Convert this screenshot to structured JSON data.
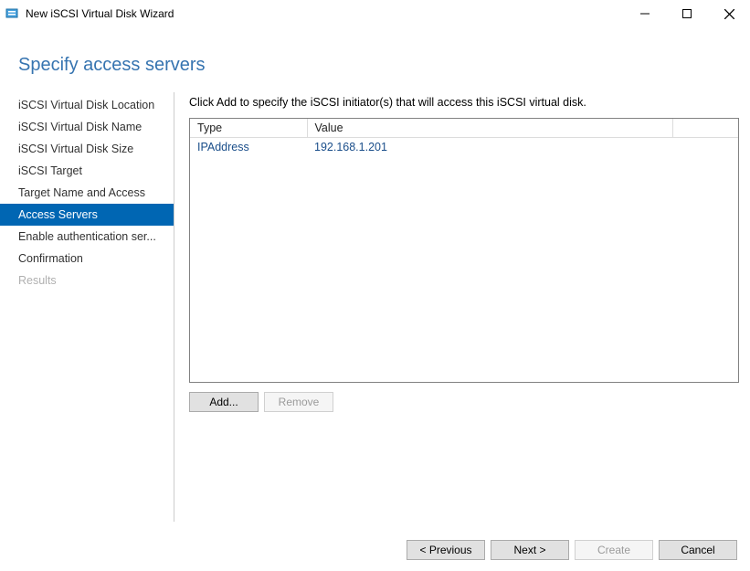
{
  "window": {
    "title": "New iSCSI Virtual Disk Wizard"
  },
  "heading": "Specify access servers",
  "sidebar": {
    "items": [
      {
        "label": "iSCSI Virtual Disk Location",
        "selected": false,
        "disabled": false
      },
      {
        "label": "iSCSI Virtual Disk Name",
        "selected": false,
        "disabled": false
      },
      {
        "label": "iSCSI Virtual Disk Size",
        "selected": false,
        "disabled": false
      },
      {
        "label": "iSCSI Target",
        "selected": false,
        "disabled": false
      },
      {
        "label": "Target Name and Access",
        "selected": false,
        "disabled": false
      },
      {
        "label": "Access Servers",
        "selected": true,
        "disabled": false
      },
      {
        "label": "Enable authentication ser...",
        "selected": false,
        "disabled": false
      },
      {
        "label": "Confirmation",
        "selected": false,
        "disabled": false
      },
      {
        "label": "Results",
        "selected": false,
        "disabled": true
      }
    ]
  },
  "main": {
    "instruction": "Click Add to specify the iSCSI initiator(s) that will access this iSCSI virtual disk.",
    "columns": {
      "type": "Type",
      "value": "Value"
    },
    "rows": [
      {
        "type": "IPAddress",
        "value": "192.168.1.201"
      }
    ],
    "add_label": "Add...",
    "remove_label": "Remove"
  },
  "footer": {
    "previous": "< Previous",
    "next": "Next >",
    "create": "Create",
    "cancel": "Cancel"
  }
}
